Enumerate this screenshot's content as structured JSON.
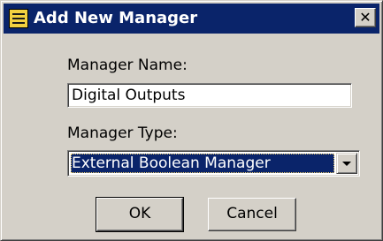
{
  "window": {
    "title": "Add New Manager",
    "close_glyph": "✕",
    "icon": "manager-icon"
  },
  "form": {
    "name_label": "Manager Name:",
    "name_value": "Digital Outputs",
    "type_label": "Manager Type:",
    "type_value": "External Boolean Manager"
  },
  "buttons": {
    "ok_label": "OK",
    "cancel_label": "Cancel"
  },
  "colors": {
    "titlebar": "#0a246a",
    "dialog_face": "#d4d0c8",
    "selection": "#0a246a"
  }
}
